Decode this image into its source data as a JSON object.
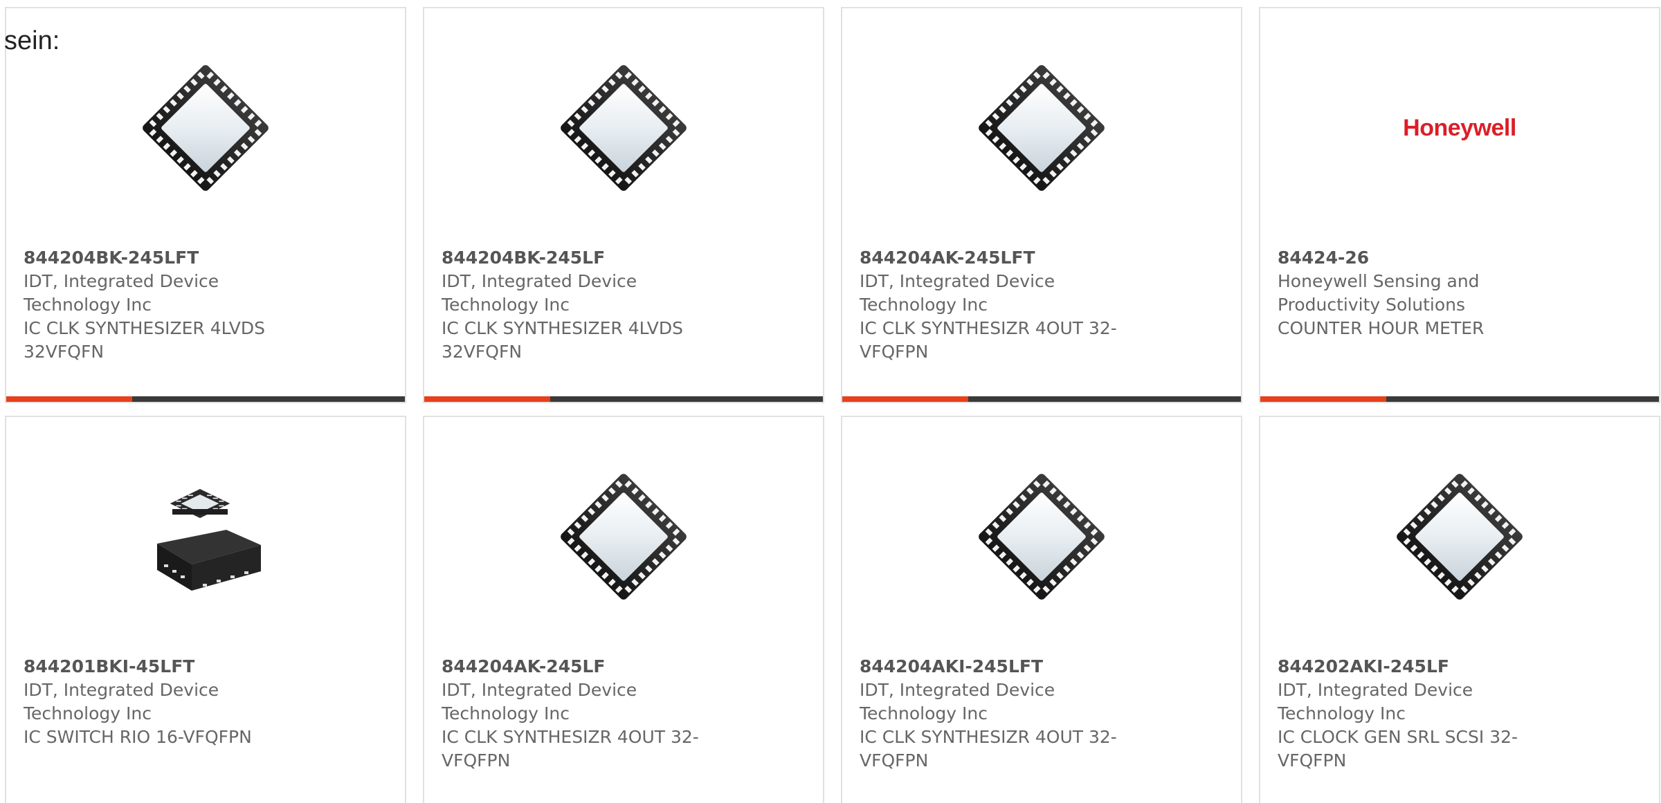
{
  "page_fragment": "sein:",
  "products": [
    {
      "part_number": "844204BK-245LFT",
      "manufacturer": "IDT, Integrated Device Technology Inc",
      "description": "IC CLK SYNTHESIZER 4LVDS 32VFQFN",
      "image_icon": "qfn-chip-icon"
    },
    {
      "part_number": "844204BK-245LF",
      "manufacturer": "IDT, Integrated Device Technology Inc",
      "description": "IC CLK SYNTHESIZER 4LVDS 32VFQFN",
      "image_icon": "qfn-chip-icon"
    },
    {
      "part_number": "844204AK-245LFT",
      "manufacturer": "IDT, Integrated Device Technology Inc",
      "description": "IC CLK SYNTHESIZR 4OUT 32-VFQFPN",
      "image_icon": "qfn-chip-icon"
    },
    {
      "part_number": "84424-26",
      "manufacturer": "Honeywell Sensing and Productivity Solutions",
      "description": "COUNTER HOUR METER",
      "image_icon": "honeywell-logo",
      "logo_text": "Honeywell"
    },
    {
      "part_number": "844201BKI-45LFT",
      "manufacturer": "IDT, Integrated Device Technology Inc",
      "description": "IC SWITCH RIO 16-VFQFPN",
      "image_icon": "qfn-package-pair-icon"
    },
    {
      "part_number": "844204AK-245LF",
      "manufacturer": "IDT, Integrated Device Technology Inc",
      "description": "IC CLK SYNTHESIZR 4OUT 32-VFQFPN",
      "image_icon": "qfn-chip-icon"
    },
    {
      "part_number": "844204AKI-245LFT",
      "manufacturer": "IDT, Integrated Device Technology Inc",
      "description": "IC CLK SYNTHESIZR 4OUT 32-VFQFPN",
      "image_icon": "qfn-chip-icon"
    },
    {
      "part_number": "844202AKI-245LF",
      "manufacturer": "IDT, Integrated Device Technology Inc",
      "description": "IC CLOCK GEN SRL SCSI 32-VFQFPN",
      "image_icon": "qfn-chip-icon"
    }
  ],
  "colors": {
    "accent": "#e8401c",
    "bar": "#3a3a3a",
    "card_border": "#e1e1e1",
    "text": "#666666",
    "honeywell_red": "#dc1e28"
  }
}
